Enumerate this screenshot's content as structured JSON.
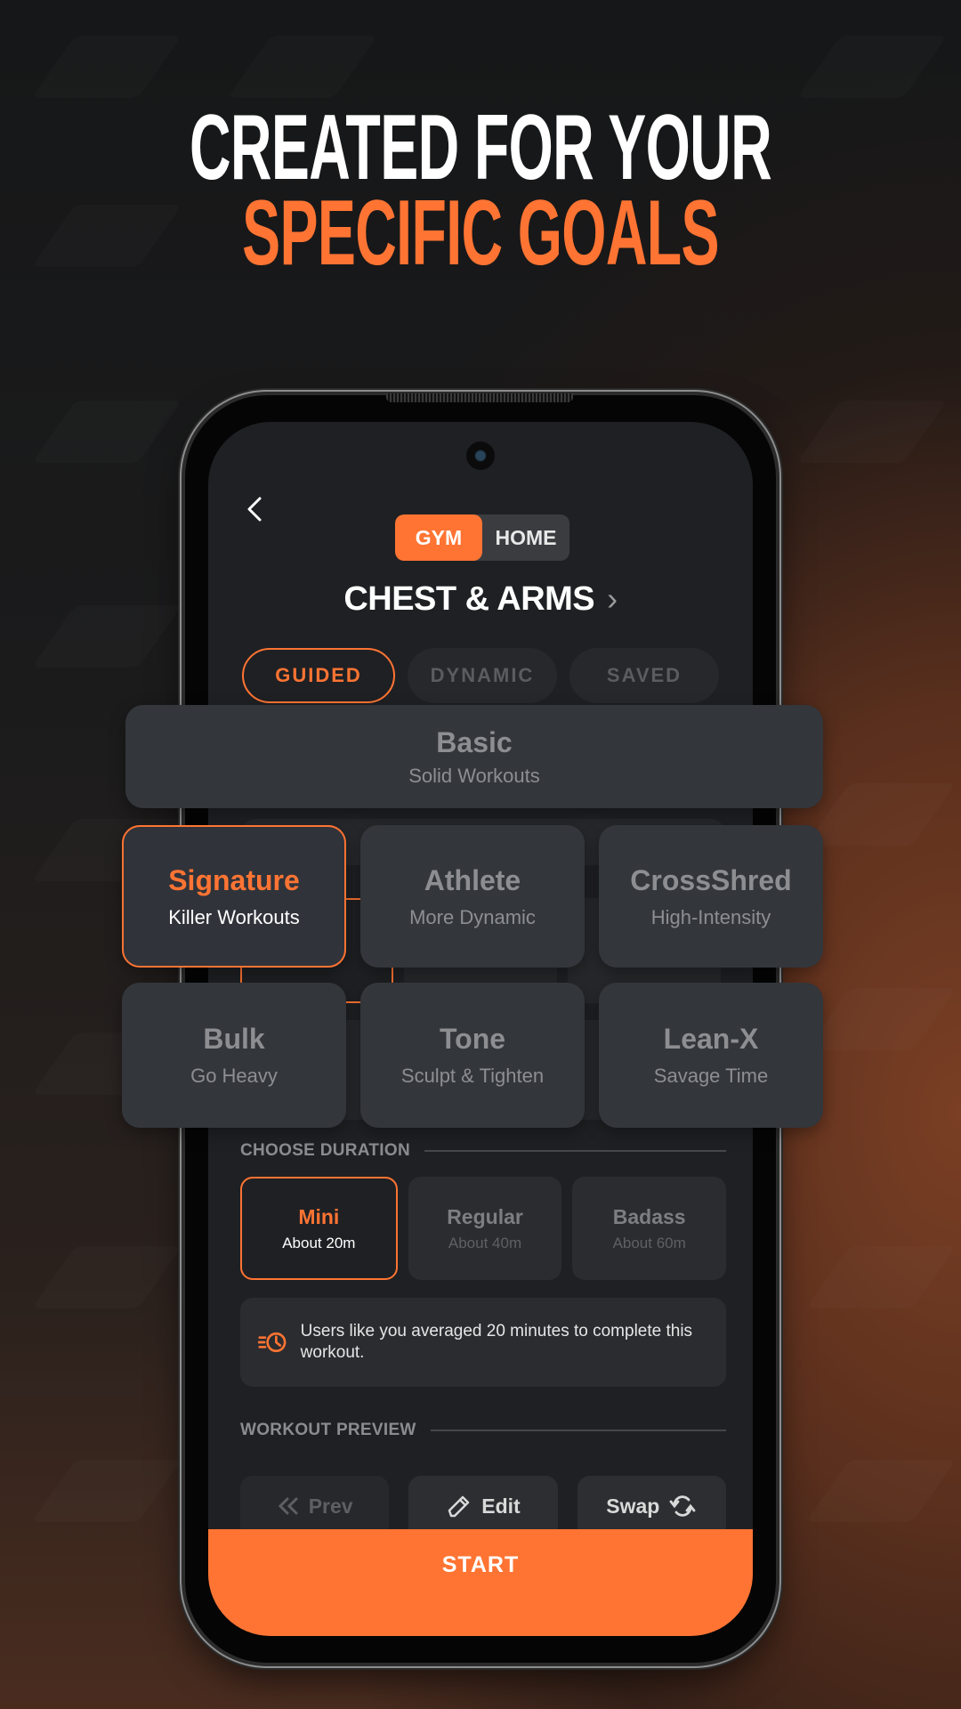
{
  "headline": {
    "line1": "CREATED FOR YOUR",
    "line2": "SPECIFIC GOALS"
  },
  "colors": {
    "accent": "#ff7433",
    "screen_bg": "#1f2023",
    "card_bg": "#33363b",
    "headline_white": "#ffffff"
  },
  "screen": {
    "back_icon": "chevron-left-icon",
    "location_toggle": {
      "options": [
        "GYM",
        "HOME"
      ],
      "selected": "GYM"
    },
    "title": "CHEST & ARMS",
    "title_chevron": "›",
    "mode_tabs": [
      {
        "label": "GUIDED",
        "active": true
      },
      {
        "label": "DYNAMIC",
        "active": false
      },
      {
        "label": "SAVED",
        "active": false
      }
    ],
    "duration": {
      "section_label": "CHOOSE DURATION",
      "options": [
        {
          "title": "Mini",
          "subtitle": "About 20m",
          "active": true
        },
        {
          "title": "Regular",
          "subtitle": "About 40m",
          "active": false
        },
        {
          "title": "Badass",
          "subtitle": "About 60m",
          "active": false
        }
      ]
    },
    "info": {
      "icon": "fast-clock-icon",
      "text": "Users like you averaged 20 minutes to complete this workout."
    },
    "preview": {
      "section_label": "WORKOUT PREVIEW",
      "buttons": [
        {
          "label": "Prev",
          "icon": "double-chevron-left-icon"
        },
        {
          "label": "Edit",
          "icon": "pencil-icon"
        },
        {
          "label": "Swap",
          "icon": "swap-icon"
        }
      ]
    },
    "start_label": "START"
  },
  "workout_styles": [
    {
      "title": "Basic",
      "subtitle": "Solid Workouts",
      "active": false
    },
    {
      "title": "Signature",
      "subtitle": "Killer Workouts",
      "active": true
    },
    {
      "title": "Athlete",
      "subtitle": "More Dynamic",
      "active": false
    },
    {
      "title": "CrossShred",
      "subtitle": "High-Intensity",
      "active": false
    },
    {
      "title": "Bulk",
      "subtitle": "Go Heavy",
      "active": false
    },
    {
      "title": "Tone",
      "subtitle": "Sculpt & Tighten",
      "active": false
    },
    {
      "title": "Lean-X",
      "subtitle": "Savage Time",
      "active": false
    }
  ]
}
